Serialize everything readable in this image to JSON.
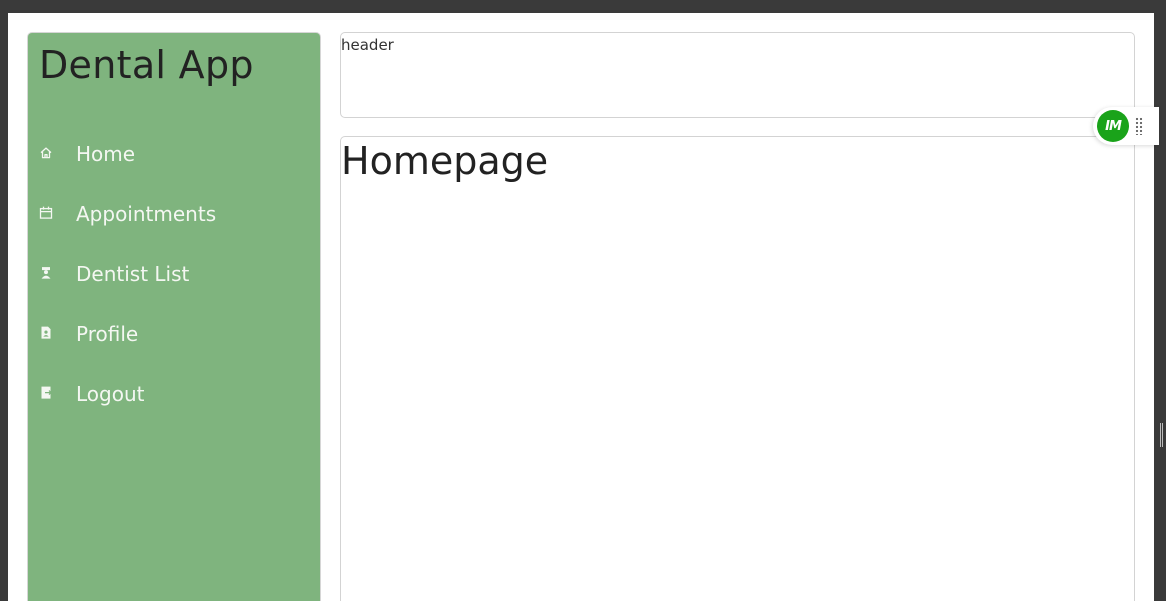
{
  "app": {
    "title": "Dental App"
  },
  "sidebar": {
    "items": [
      {
        "label": "Home",
        "icon": "home-icon"
      },
      {
        "label": "Appointments",
        "icon": "calendar-icon"
      },
      {
        "label": "Dentist List",
        "icon": "dentist-icon"
      },
      {
        "label": "Profile",
        "icon": "profile-icon"
      },
      {
        "label": "Logout",
        "icon": "logout-icon"
      }
    ],
    "background": "#7fb47e"
  },
  "header": {
    "text": "header"
  },
  "main": {
    "title": "Homepage"
  },
  "extension": {
    "badge_text": "IM",
    "badge_color": "#1aa31a"
  }
}
